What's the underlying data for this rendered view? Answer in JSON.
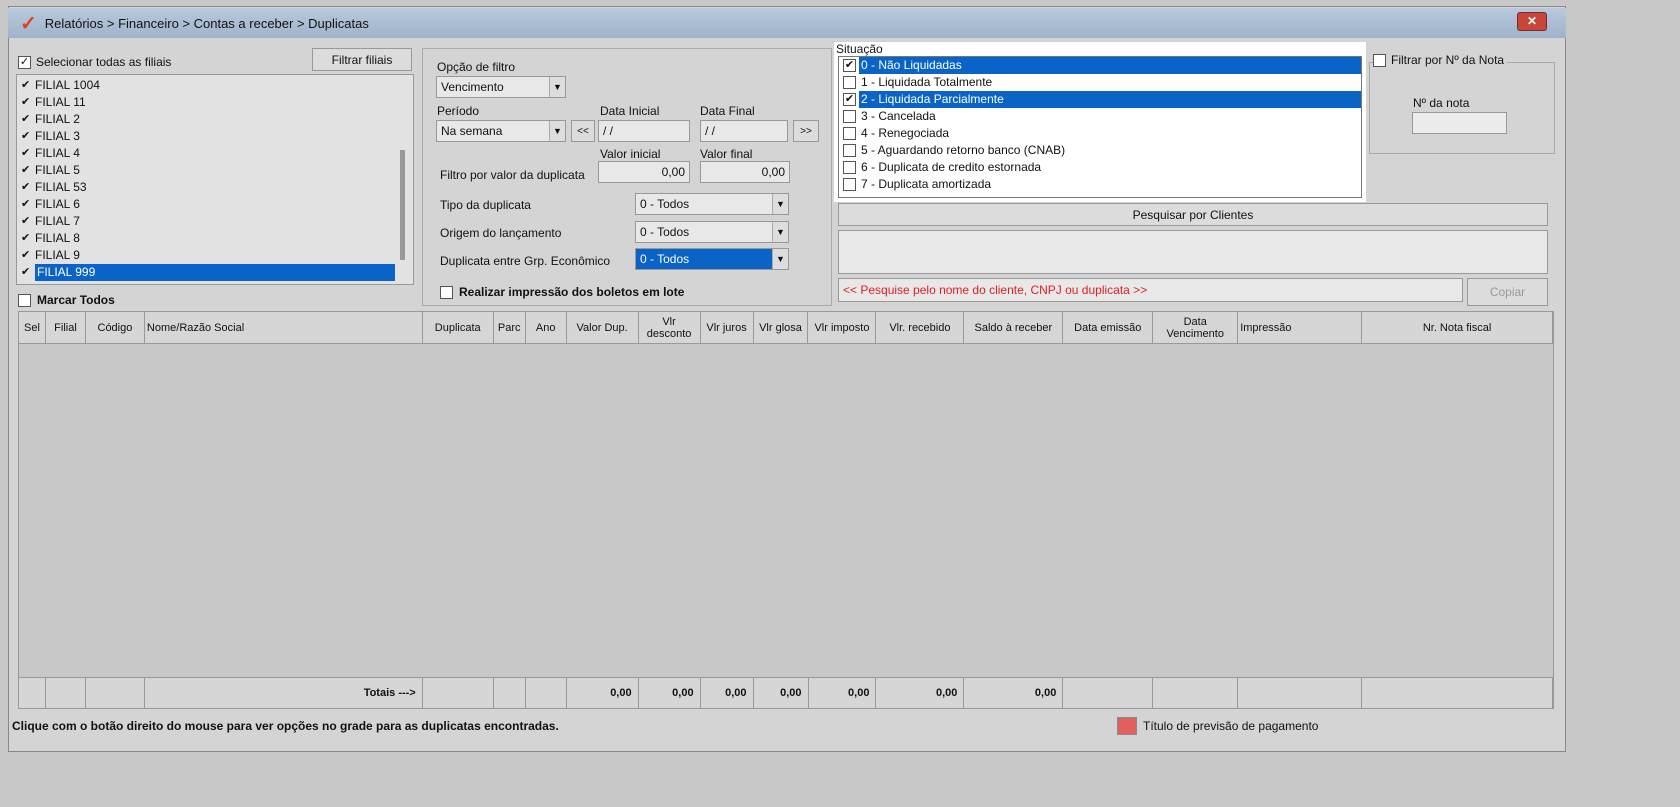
{
  "window": {
    "title": "Relatórios > Financeiro > Contas a receber > Duplicatas",
    "close": "✕"
  },
  "filiais": {
    "select_all_label": "Selecionar todas as filiais",
    "filter_button": "Filtrar filiais",
    "items": [
      "FILIAL 1004",
      "FILIAL 11",
      "FILIAL 2",
      "FILIAL 3",
      "FILIAL 4",
      "FILIAL 5",
      "FILIAL 53",
      "FILIAL 6",
      "FILIAL 7",
      "FILIAL 8",
      "FILIAL 9",
      "FILIAL 999"
    ],
    "selected_index": 11,
    "mark_all_label": "Marcar Todos"
  },
  "filtro": {
    "opcao_label": "Opção de filtro",
    "opcao_value": "Vencimento",
    "periodo_label": "Período",
    "periodo_value": "Na semana",
    "prev": "<<",
    "next": ">>",
    "data_inicial_label": "Data Inicial",
    "data_inicial": " / /",
    "data_final_label": "Data Final",
    "data_final": " / /",
    "valor_inicial_label": "Valor inicial",
    "valor_final_label": "Valor final",
    "valor_filter_label": "Filtro por valor da duplicata",
    "valor_inicial": "0,00",
    "valor_final": "0,00",
    "tipo_label": "Tipo da duplicata",
    "tipo_value": "0 - Todos",
    "origem_label": "Origem do lançamento",
    "origem_value": "0 - Todos",
    "grupo_label": "Duplicata entre Grp. Econômico",
    "grupo_value": "0 - Todos",
    "boletos_label": "Realizar impressão dos boletos em lote"
  },
  "situacao": {
    "label": "Situação",
    "items": [
      {
        "label": "0 - Não Liquidadas",
        "checked": true,
        "selected": true
      },
      {
        "label": "1 - Liquidada Totalmente",
        "checked": false,
        "selected": false
      },
      {
        "label": "2 - Liquidada Parcialmente",
        "checked": true,
        "selected": true
      },
      {
        "label": "3 - Cancelada",
        "checked": false,
        "selected": false
      },
      {
        "label": "4 - Renegociada",
        "checked": false,
        "selected": false
      },
      {
        "label": "5 - Aguardando retorno banco (CNAB)",
        "checked": false,
        "selected": false
      },
      {
        "label": "6 - Duplicata de credito estornada",
        "checked": false,
        "selected": false
      },
      {
        "label": "7 - Duplicata amortizada",
        "checked": false,
        "selected": false
      }
    ]
  },
  "nota": {
    "filter_label": "Filtrar por Nº da Nota",
    "field_label": "Nº da nota",
    "value": ""
  },
  "clientes": {
    "search_button": "Pesquisar por Clientes",
    "hint": "<< Pesquise pelo nome do cliente, CNPJ ou duplicata >>",
    "copy_button": "Copiar"
  },
  "grid": {
    "columns": [
      "Sel",
      "Filial",
      "Código",
      "Nome/Razão Social",
      "Duplicata",
      "Parc",
      "Ano",
      "Valor Dup.",
      "Vlr desconto",
      "Vlr juros",
      "Vlr glosa",
      "Vlr imposto",
      "Vlr. recebido",
      "Saldo à receber",
      "Data emissão",
      "Data Vencimento",
      "Impressão",
      "Nr. Nota fiscal"
    ],
    "totals": [
      "",
      "",
      "",
      "Totais --->",
      "",
      "",
      "",
      "0,00",
      "0,00",
      "0,00",
      "0,00",
      "0,00",
      "0,00",
      "0,00",
      "",
      "",
      "",
      ""
    ]
  },
  "status": {
    "hint": "Clique com o botão direito do mouse para ver opções no grade para as duplicatas encontradas.",
    "legend_label": "Título de previsão de pagamento",
    "legend_color": "#e06060"
  }
}
